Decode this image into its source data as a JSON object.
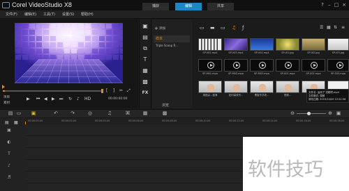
{
  "app": {
    "title": "Corel VideoStudio X8"
  },
  "steps": {
    "capture": "捕获",
    "edit": "编辑",
    "share": "共享"
  },
  "window": {
    "help": "?",
    "minimize": "–",
    "maximize": "□",
    "close": "×"
  },
  "menu": {
    "file": "文件(F)",
    "edit": "编辑(E)",
    "tools": "工具(T)",
    "settings": "设置(S)",
    "help": "帮助(H)"
  },
  "player": {
    "mode_project": "项目",
    "mode_clip": "素材",
    "timecode": "00:00:00:00",
    "resolution": "HD",
    "progress": 0.02,
    "controls": [
      "⏮",
      "◀◀",
      "▶",
      "▶▶",
      "⏭",
      "🔁",
      "🔊"
    ]
  },
  "library": {
    "add_label": "添加",
    "folders": [
      {
        "name": "样本",
        "selected": true
      },
      {
        "name": "Triple Scoop R...",
        "selected": false
      }
    ],
    "toolbar_icons": [
      "📁",
      "🎞",
      "🖼",
      "🎵",
      "ƒ",
      "🔍"
    ],
    "thumbnails": [
      {
        "label": "SP-V02.mp4",
        "kind": "keyboard"
      },
      {
        "label": "SP-V03.mp4",
        "kind": "cyber"
      },
      {
        "label": "SP-V04.mp4",
        "kind": "blue"
      },
      {
        "label": "SP-I01.jpg",
        "kind": "yellow"
      },
      {
        "label": "SP-I02.jpg",
        "kind": "flower"
      },
      {
        "label": "SP-I03.jpg",
        "kind": "light"
      },
      {
        "label": "SP-M01.mpa",
        "kind": "film"
      },
      {
        "label": "SP-M02.mpa",
        "kind": "film"
      },
      {
        "label": "SP-M03.mpa",
        "kind": "film"
      },
      {
        "label": "SP-S01.mpa",
        "kind": "film"
      },
      {
        "label": "SP-S02.mpa",
        "kind": "film"
      },
      {
        "label": "SP-S03.mpa",
        "kind": "film"
      },
      {
        "label": "用指尖...蓝海",
        "kind": "hand"
      },
      {
        "label": "如何高效写...",
        "kind": "hand"
      },
      {
        "label": "黑板写字老...",
        "kind": "hand2"
      },
      {
        "label": "视频...",
        "kind": "hand"
      },
      {
        "label": "运用手写...",
        "kind": "hand2"
      },
      {
        "label": "",
        "kind": "white"
      }
    ],
    "tooltip": {
      "line1": "文件名: 运用了 流程吧.mp4",
      "line2": "文件格式: 视频",
      "line3": "修改日期: 2015/10/20 12:22:58"
    },
    "bottom_label": "浏览"
  },
  "timeline": {
    "ruler_ticks": [
      "00:00:00:00",
      "00:00:02:00",
      "00:00:04:00",
      "00:00:06:00",
      "00:00:08:00",
      "00:00:10:00",
      "00:00:12:00",
      "00:00:14:00",
      "00:00:16:00",
      "00:00:18:00"
    ],
    "tool_icons": [
      "▤",
      "▭",
      "⇄",
      "↶",
      "↷",
      "◎",
      "♫",
      "⌘",
      "⛁",
      "✎",
      "▦",
      "⊕",
      "⊖",
      "▣",
      "⤢"
    ],
    "track_icons": [
      "▣",
      "◐",
      "T",
      "♪",
      "♬"
    ]
  },
  "watermark": {
    "text": "软件技巧"
  }
}
